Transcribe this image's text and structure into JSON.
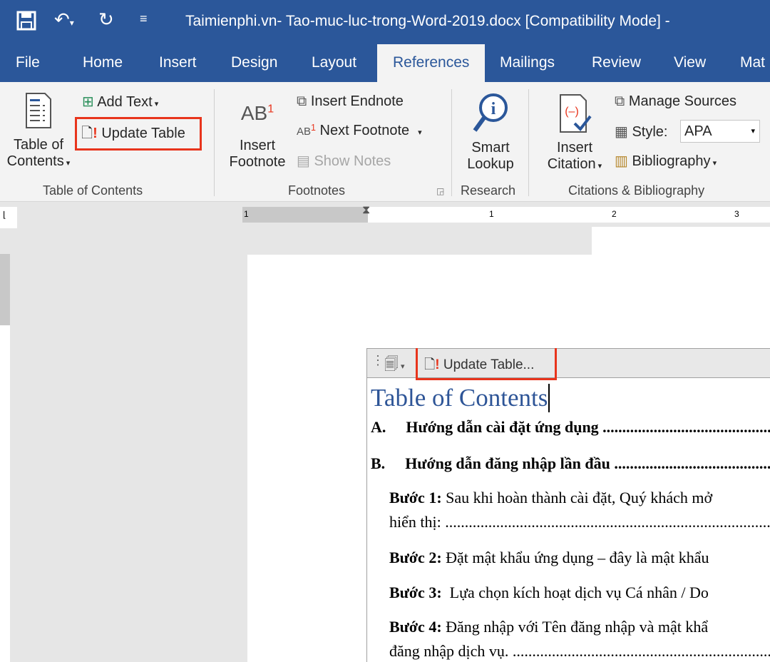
{
  "title_bar": {
    "title": "Taimienphi.vn- Tao-muc-luc-trong-Word-2019.docx [Compatibility Mode]  -",
    "save_icon": "save-icon",
    "undo_icon": "undo-icon",
    "redo_icon": "redo-icon"
  },
  "tabs": [
    "File",
    "Home",
    "Insert",
    "Design",
    "Layout",
    "References",
    "Mailings",
    "Review",
    "View",
    "Mat"
  ],
  "active_tab": "References",
  "ribbon": {
    "toc_group": {
      "toc_button_line1": "Table of",
      "toc_button_line2": "Contents",
      "add_text": "Add Text",
      "update_table": "Update Table",
      "label": "Table of Contents"
    },
    "footnotes_group": {
      "insert_footnote_line1": "Insert",
      "insert_footnote_line2": "Footnote",
      "insert_endnote": "Insert Endnote",
      "next_footnote": "Next Footnote",
      "show_notes": "Show Notes",
      "label": "Footnotes"
    },
    "research_group": {
      "smart_lookup_line1": "Smart",
      "smart_lookup_line2": "Lookup",
      "label": "Research"
    },
    "citations_group": {
      "insert_citation_line1": "Insert",
      "insert_citation_line2": "Citation",
      "manage_sources": "Manage Sources",
      "style_label": "Style:",
      "style_value": "APA",
      "bibliography": "Bibliography",
      "label": "Citations & Bibliography"
    }
  },
  "ruler": {
    "marks": [
      "1",
      "1",
      "2",
      "3"
    ]
  },
  "document": {
    "toc_control": {
      "update_table": "Update Table..."
    },
    "toc_title": "Table of Contents",
    "entries": [
      {
        "num": "A.",
        "text": "Hướng dẫn cài đặt ứng dụng ........................................................"
      },
      {
        "num": "B.",
        "text": "Hướng dẫn đăng nhập lần đầu ...................................................."
      }
    ],
    "steps": [
      {
        "label": "Bước 1:",
        "text": " Sau khi hoàn thành cài đặt, Quý khách mở",
        "cont": "hiển thị: ..........................................................................................."
      },
      {
        "label": "Bước 2:",
        "text": " Đặt mật khẩu ứng dụng – đây là mật khẩu"
      },
      {
        "label": "Bước 3:",
        "text": "  Lựa chọn kích hoạt dịch vụ Cá nhân / Do"
      },
      {
        "label": "Bước 4:",
        "text": " Đăng nhập với Tên đăng nhập và mật khẩ",
        "cont": "đăng nhập dịch vụ. ..........................................................................."
      }
    ]
  },
  "colors": {
    "brand": "#2b579a",
    "highlight": "#e8341c",
    "heading": "#2e5597"
  }
}
